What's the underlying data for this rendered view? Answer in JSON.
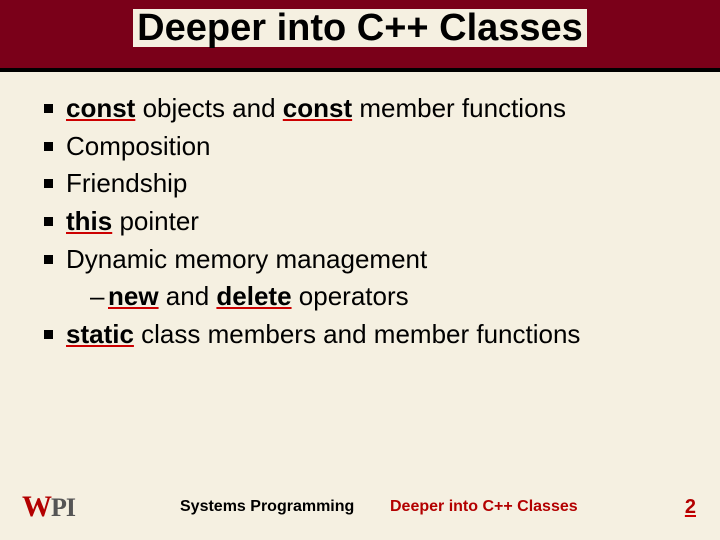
{
  "title": "Deeper into C++ Classes",
  "bullets": {
    "b1": {
      "kw1": "const",
      "t1": " objects and ",
      "kw2": "const",
      "t2": " member functions"
    },
    "b2": {
      "text": "Composition"
    },
    "b3": {
      "text": "Friendship"
    },
    "b4": {
      "kw": "this",
      "t": " pointer"
    },
    "b5": {
      "text": "Dynamic memory management",
      "sub": {
        "dash": "–",
        "kw1": "new",
        "t1": " and ",
        "kw2": "delete",
        "t2": " operators"
      }
    },
    "b6": {
      "kw": "static",
      "t": " class members and member functions"
    }
  },
  "footer": {
    "logo": {
      "w": "W",
      "p": "P",
      "i": "I"
    },
    "left": "Systems Programming",
    "mid": "Deeper into C++ Classes",
    "page": "2"
  }
}
